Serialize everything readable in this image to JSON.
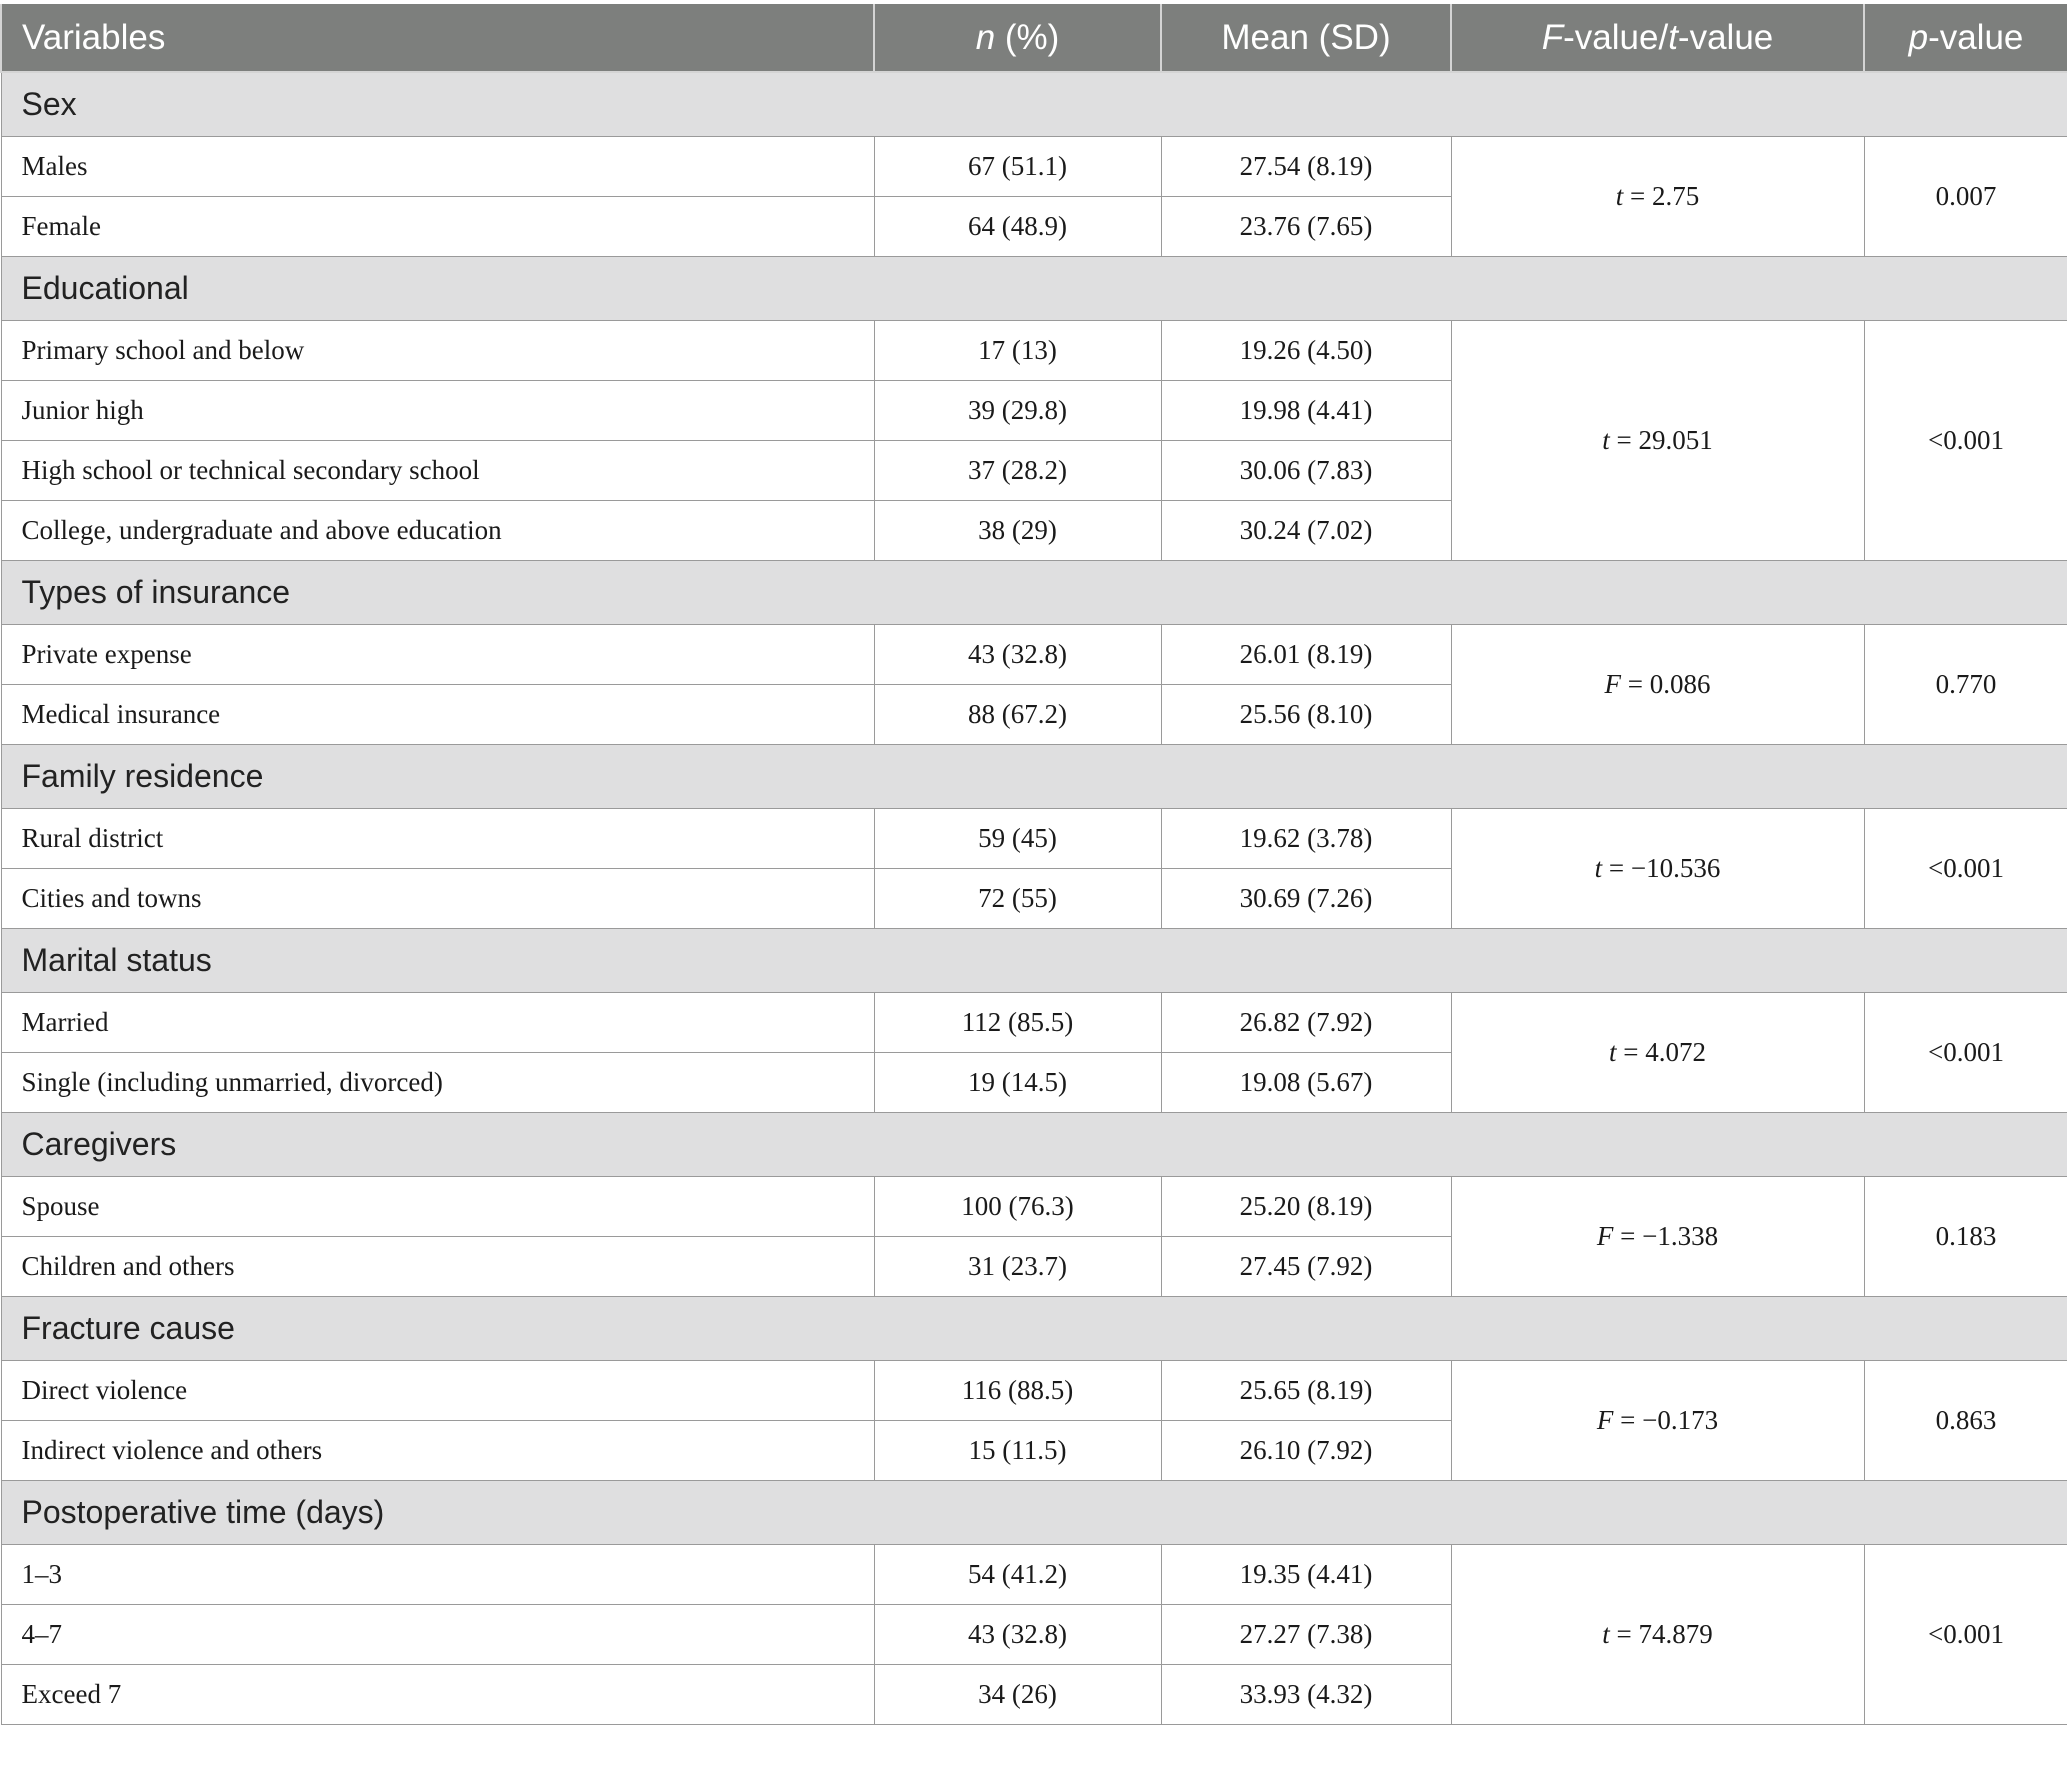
{
  "header": {
    "variables": "Variables",
    "n_italic": "n",
    "n_rest": " (%)",
    "mean_sd": "Mean (SD)",
    "f_italic": "F",
    "f_mid": "-value/",
    "t_italic": "t",
    "t_rest": "-value",
    "p_italic": "p",
    "p_rest": "-value"
  },
  "groups": [
    {
      "title": "Sex",
      "stat_symbol": "t",
      "stat_value": " = 2.75",
      "p_value": "0.007",
      "rows": [
        {
          "label": "Males",
          "n": "67 (51.1)",
          "mean": "27.54 (8.19)"
        },
        {
          "label": "Female",
          "n": "64 (48.9)",
          "mean": "23.76 (7.65)"
        }
      ]
    },
    {
      "title": "Educational",
      "stat_symbol": "t",
      "stat_value": " = 29.051",
      "p_value": "<0.001",
      "rows": [
        {
          "label": "Primary school and below",
          "n": "17 (13)",
          "mean": "19.26 (4.50)"
        },
        {
          "label": "Junior high",
          "n": "39 (29.8)",
          "mean": "19.98 (4.41)"
        },
        {
          "label": "High school or technical secondary school",
          "n": "37 (28.2)",
          "mean": "30.06 (7.83)"
        },
        {
          "label": "College, undergraduate and above education",
          "n": "38 (29)",
          "mean": "30.24 (7.02)"
        }
      ]
    },
    {
      "title": "Types of insurance",
      "stat_symbol": "F",
      "stat_value": " = 0.086",
      "p_value": "0.770",
      "rows": [
        {
          "label": "Private expense",
          "n": "43 (32.8)",
          "mean": "26.01 (8.19)"
        },
        {
          "label": "Medical insurance",
          "n": "88 (67.2)",
          "mean": "25.56 (8.10)"
        }
      ]
    },
    {
      "title": "Family residence",
      "stat_symbol": "t",
      "stat_value": " = −10.536",
      "p_value": "<0.001",
      "rows": [
        {
          "label": "Rural district",
          "n": "59 (45)",
          "mean": "19.62 (3.78)"
        },
        {
          "label": "Cities and towns",
          "n": "72 (55)",
          "mean": "30.69 (7.26)"
        }
      ]
    },
    {
      "title": "Marital status",
      "stat_symbol": "t",
      "stat_value": " = 4.072",
      "p_value": "<0.001",
      "rows": [
        {
          "label": "Married",
          "n": "112 (85.5)",
          "mean": "26.82 (7.92)"
        },
        {
          "label": "Single (including unmarried, divorced)",
          "n": "19 (14.5)",
          "mean": "19.08 (5.67)"
        }
      ]
    },
    {
      "title": "Caregivers",
      "stat_symbol": "F",
      "stat_value": " = −1.338",
      "p_value": "0.183",
      "rows": [
        {
          "label": "Spouse",
          "n": "100 (76.3)",
          "mean": "25.20 (8.19)"
        },
        {
          "label": "Children and others",
          "n": "31 (23.7)",
          "mean": "27.45 (7.92)"
        }
      ]
    },
    {
      "title": "Fracture cause",
      "stat_symbol": "F",
      "stat_value": " = −0.173",
      "p_value": "0.863",
      "rows": [
        {
          "label": "Direct violence",
          "n": "116 (88.5)",
          "mean": "25.65 (8.19)"
        },
        {
          "label": "Indirect violence and others",
          "n": "15 (11.5)",
          "mean": "26.10 (7.92)"
        }
      ]
    },
    {
      "title": "Postoperative time (days)",
      "stat_symbol": "t",
      "stat_value": " = 74.879",
      "p_value": "<0.001",
      "rows": [
        {
          "label": "1–3",
          "n": "54 (41.2)",
          "mean": "19.35 (4.41)"
        },
        {
          "label": "4–7",
          "n": "43 (32.8)",
          "mean": "27.27 (7.38)"
        },
        {
          "label": "Exceed 7",
          "n": "34 (26)",
          "mean": "33.93 (4.32)"
        }
      ]
    }
  ]
}
